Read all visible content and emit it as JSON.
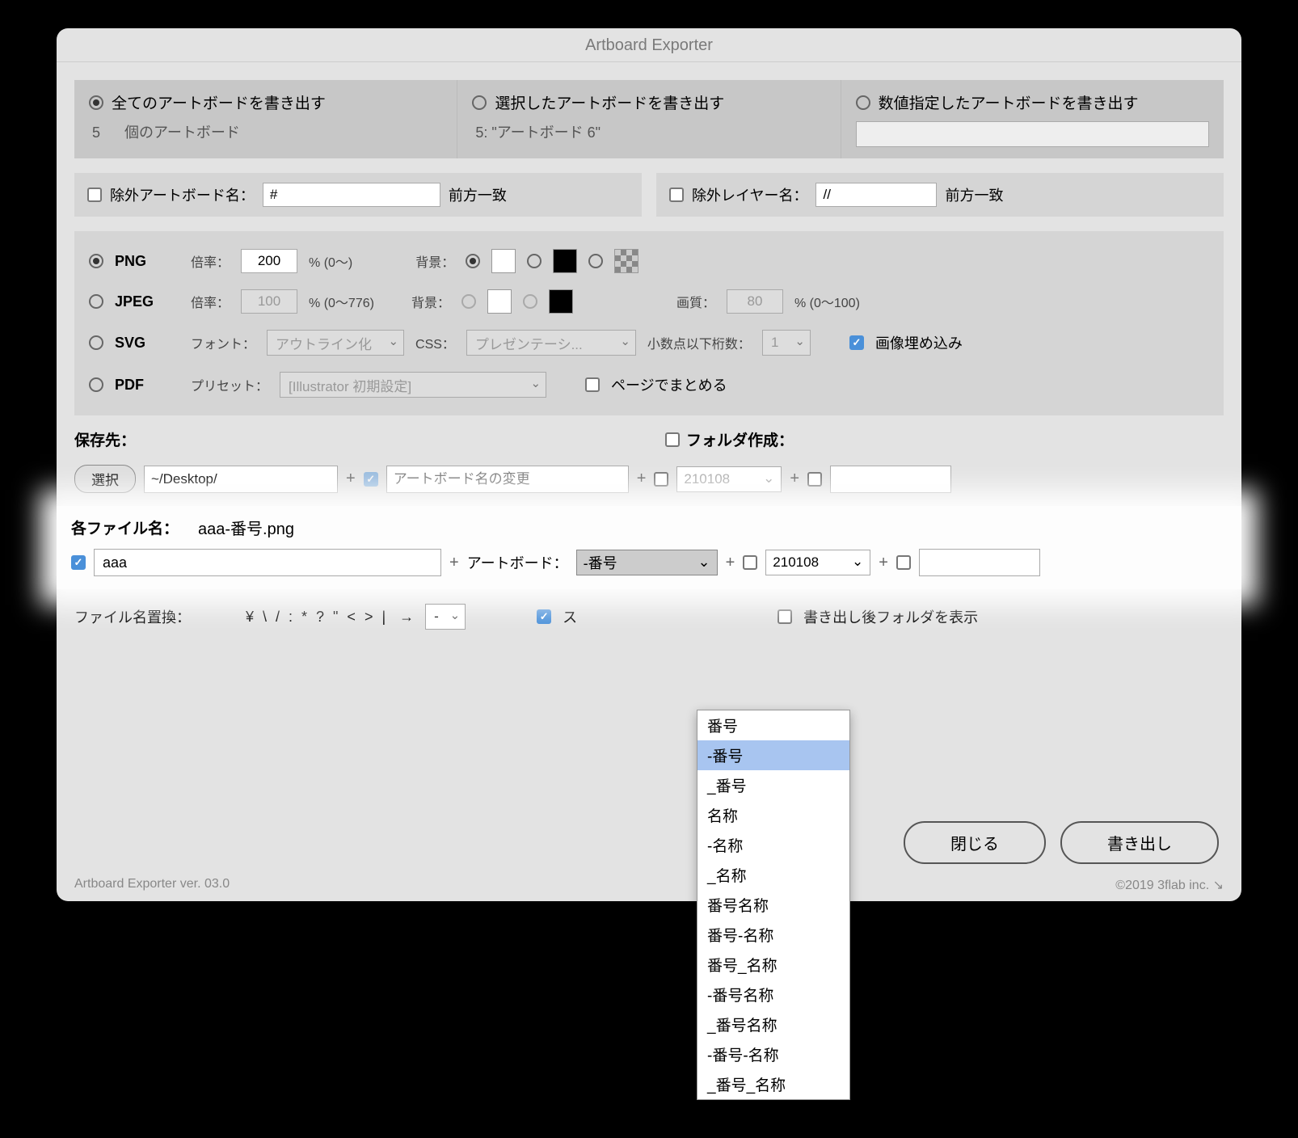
{
  "title": "Artboard Exporter",
  "mode": {
    "all": {
      "label": "全てのアートボードを書き出す",
      "sub_count": "5",
      "sub_label": "個のアートボード"
    },
    "sel": {
      "label": "選択したアートボードを書き出す",
      "sub": "5: \"アートボード 6\""
    },
    "num": {
      "label": "数値指定したアートボードを書き出す"
    }
  },
  "exclude": {
    "artboard_label": "除外アートボード名：",
    "artboard_value": "#",
    "layer_label": "除外レイヤー名：",
    "layer_value": "//",
    "match": "前方一致"
  },
  "fmt": {
    "png": "PNG",
    "jpeg": "JPEG",
    "svg": "SVG",
    "pdf": "PDF",
    "scale": "倍率：",
    "scale_png": "200",
    "scale_jpeg": "100",
    "scale_range_png": "% (0〜)",
    "scale_range_jpeg": "% (0〜776)",
    "bg": "背景：",
    "quality": "画質：",
    "quality_val": "80",
    "quality_range": "% (0〜100)",
    "font": "フォント：",
    "font_val": "アウトライン化",
    "css": "CSS：",
    "css_val": "プレゼンテーシ...",
    "decimal": "小数点以下桁数：",
    "decimal_val": "1",
    "embed": "画像埋め込み",
    "preset": "プリセット：",
    "preset_val": "[Illustrator 初期設定]",
    "page_merge": "ページでまとめる"
  },
  "save": {
    "label": "保存先：",
    "select_btn": "選択",
    "path": "~/Desktop/",
    "folder_label": "フォルダ作成：",
    "folder_placeholder": "アートボード名の変更",
    "date": "210108"
  },
  "file": {
    "label": "各ファイル名：",
    "preview": "aaa-番号.png",
    "input_val": "aaa",
    "artboard_lbl": "アートボード：",
    "dropdown_val": "-番号",
    "date": "210108"
  },
  "dropdown_options": [
    "番号",
    "-番号",
    "_番号",
    "名称",
    "-名称",
    "_名称",
    "番号名称",
    "番号-名称",
    "番号_名称",
    "-番号名称",
    "_番号名称",
    "-番号-名称",
    "_番号_名称"
  ],
  "replace": {
    "label": "ファイル名置換：",
    "chars": "¥ \\ / : * ? \" < > |",
    "arrow": "→",
    "sel": "-",
    "space_label": "ス",
    "open_folder": "書き出し後フォルダを表示"
  },
  "buttons": {
    "close": "閉じる",
    "export": "書き出し"
  },
  "footer": {
    "ver": "Artboard Exporter ver. 03.0",
    "copy": "©2019 3flab inc. ↘"
  }
}
